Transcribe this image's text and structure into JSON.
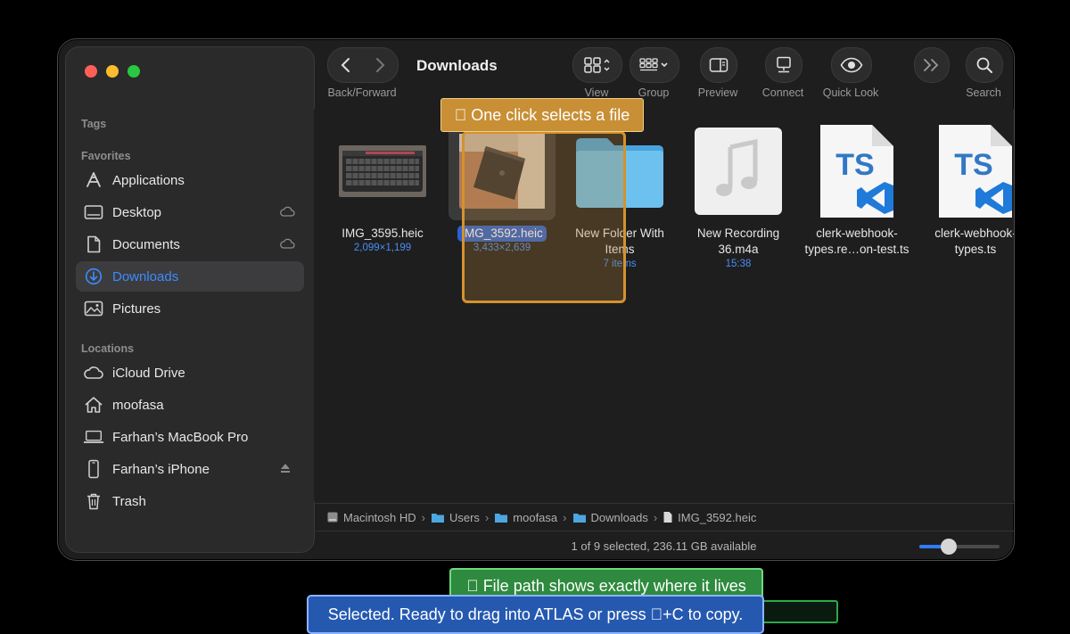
{
  "sidebar": {
    "tags_label": "Tags",
    "favorites_label": "Favorites",
    "locations_label": "Locations",
    "favorites": [
      {
        "label": "Applications",
        "icon": "applications-icon"
      },
      {
        "label": "Desktop",
        "icon": "desktop-icon",
        "badge": "icloud-icon"
      },
      {
        "label": "Documents",
        "icon": "document-icon",
        "badge": "icloud-icon"
      },
      {
        "label": "Downloads",
        "icon": "download-icon",
        "selected": true
      },
      {
        "label": "Pictures",
        "icon": "pictures-icon"
      }
    ],
    "locations": [
      {
        "label": "iCloud Drive",
        "icon": "icloud-icon"
      },
      {
        "label": "moofasa",
        "icon": "home-icon"
      },
      {
        "label": "Farhan’s MacBook Pro",
        "icon": "laptop-icon"
      },
      {
        "label": "Farhan’s iPhone",
        "icon": "iphone-icon",
        "badge": "eject-icon"
      },
      {
        "label": "Trash",
        "icon": "trash-icon"
      }
    ]
  },
  "toolbar": {
    "title": "Downloads",
    "back_forward_label": "Back/Forward",
    "view_label": "View",
    "group_label": "Group",
    "preview_label": "Preview",
    "connect_label": "Connect",
    "quicklook_label": "Quick Look",
    "search_label": "Search"
  },
  "files": [
    {
      "name": "IMG_3595.heic",
      "name2": "",
      "sub": "2,099×1,199",
      "kind": "photo-keyboard"
    },
    {
      "name": "IMG_3592.heic",
      "name2": "",
      "sub": "3,433×2,639",
      "kind": "photo-tablet",
      "selected": true
    },
    {
      "name": "New Folder With",
      "name2": "Items",
      "sub": "7 items",
      "kind": "folder"
    },
    {
      "name": "New Recording",
      "name2": "36.m4a",
      "sub": "15:38",
      "kind": "audio"
    },
    {
      "name": "clerk-webhook-",
      "name2": "types.re…on-test.ts",
      "sub": "",
      "kind": "ts"
    },
    {
      "name": "clerk-webhook-",
      "name2": "types.ts",
      "sub": "",
      "kind": "ts"
    }
  ],
  "ts_badge": "TS",
  "path": [
    "Macintosh HD",
    "Users",
    "moofasa",
    "Downloads",
    "IMG_3592.heic"
  ],
  "status": "1 of 9 selected, 236.11 GB available",
  "zoom_level": 0.32,
  "callouts": {
    "top": "\u0000 One click selects a file",
    "green": "\u0000 File path shows exactly where it lives",
    "blue": "Selected. Ready to drag into ATLAS or press \u0000+C to copy."
  },
  "colors": {
    "accent": "#2f7cf6",
    "callout_orange": "#c88f35",
    "callout_green": "#2e8a3e",
    "callout_blue": "#2559b0"
  }
}
